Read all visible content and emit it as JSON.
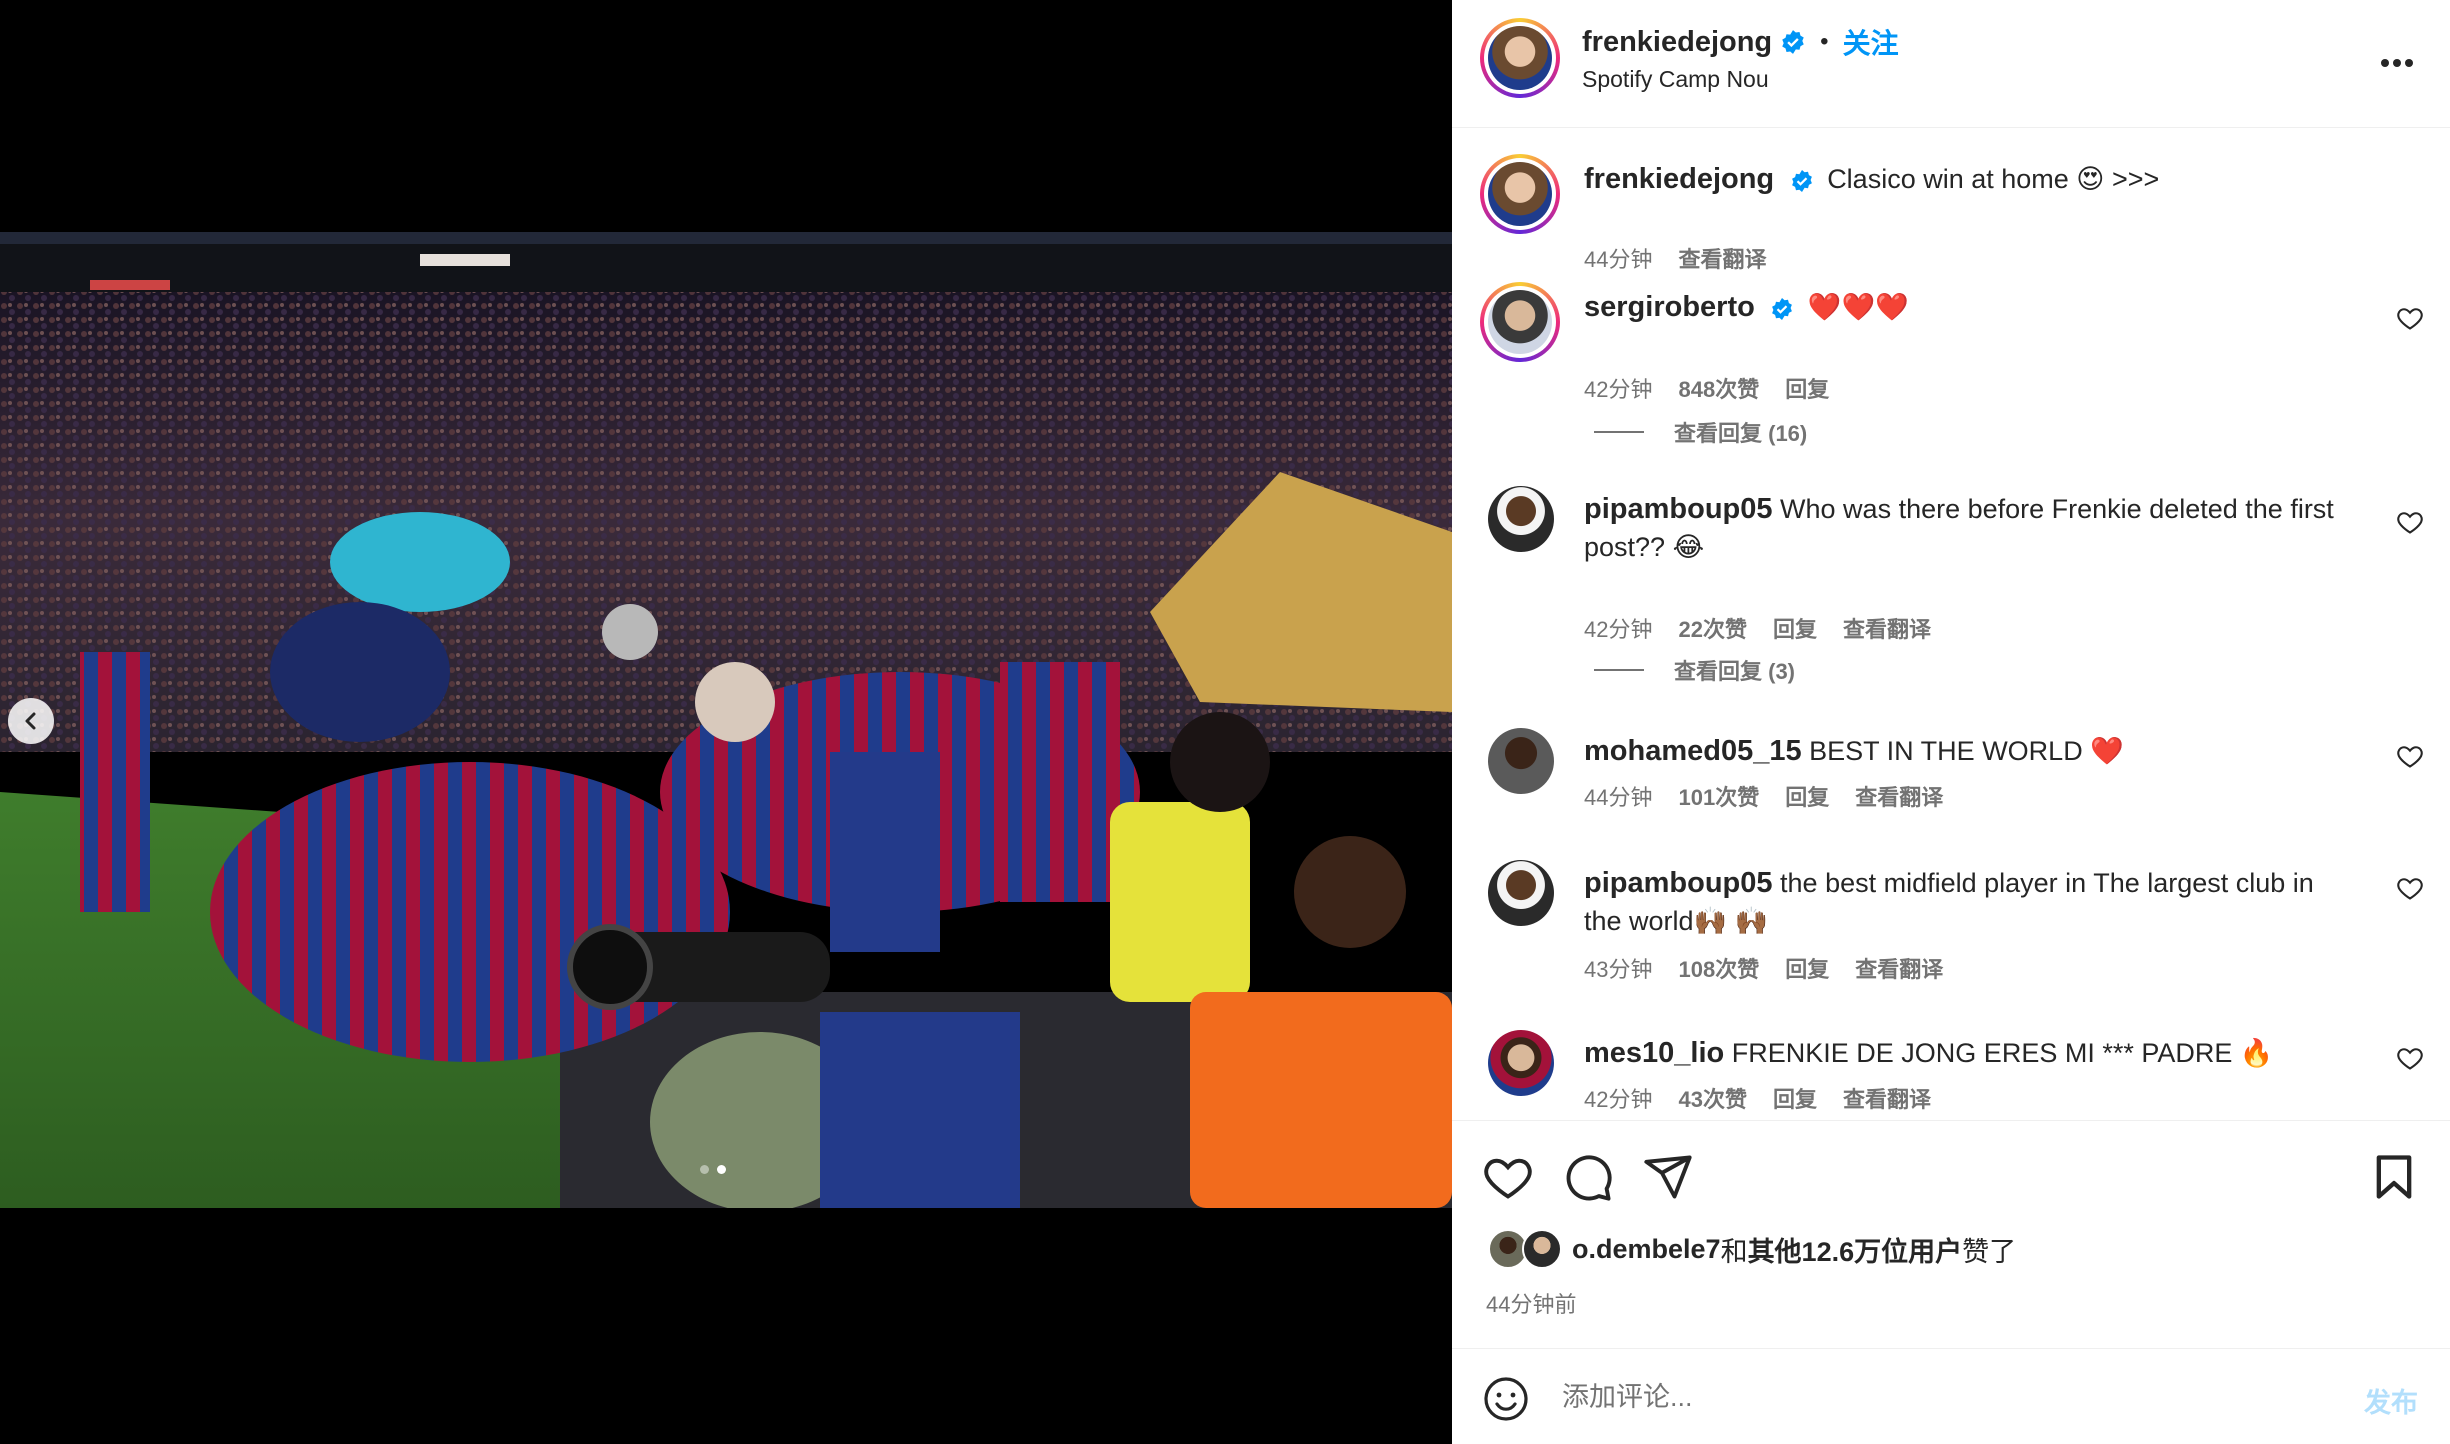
{
  "post": {
    "author": "frenkiedejong",
    "follow_label": "关注",
    "separator": "•",
    "location": "Spotify Camp Nou",
    "more_label": "···"
  },
  "comments": [
    {
      "user": "frenkiedejong",
      "text": "Clasico win at home 😍 >>>",
      "time": "44分钟",
      "likes": "",
      "reply": "",
      "translate": "查看翻译",
      "caption": true
    },
    {
      "user": "sergiroberto",
      "text": "❤️❤️❤️",
      "time": "42分钟",
      "likes": "848次赞",
      "reply": "回复",
      "translate": "",
      "view_replies": "查看回复 (16)"
    },
    {
      "user": "pipamboup05",
      "text": "Who was there before Frenkie deleted the first",
      "text2": "post?? 😂",
      "time": "42分钟",
      "likes": "22次赞",
      "reply": "回复",
      "translate": "查看翻译",
      "view_replies": "查看回复 (3)"
    },
    {
      "user": "mohamed05_15",
      "text": "BEST IN THE WORLD ❤️",
      "time": "44分钟",
      "likes": "101次赞",
      "reply": "回复",
      "translate": "查看翻译"
    },
    {
      "user": "pipamboup05",
      "text": "the best midfield player in The largest club in",
      "text2": "the world🙌🏾 🙌🏾",
      "time": "43分钟",
      "likes": "108次赞",
      "reply": "回复",
      "translate": "查看翻译"
    },
    {
      "user": "mes10_lio",
      "text": "FRENKIE DE JONG ERES MI *** PADRE 🔥",
      "time": "42分钟",
      "likes": "43次赞",
      "reply": "回复",
      "translate": "查看翻译"
    }
  ],
  "likes_summary": {
    "user": "o.dembele7",
    "mid": "和",
    "others": "其他12.6万位用户",
    "tail": "赞了"
  },
  "posted_ago": "44分钟前",
  "composer": {
    "placeholder": "添加评论...",
    "post_label": "发布"
  },
  "icons": [
    "verified-badge-icon",
    "more-icon",
    "heart-icon",
    "comment-icon",
    "share-icon",
    "bookmark-icon",
    "emoji-icon",
    "chevron-left-icon"
  ],
  "colors": {
    "accent": "#0095f6",
    "post_disabled": "#b2dffc",
    "meta": "#737373",
    "text": "#262626"
  },
  "carousel": {
    "total": 2,
    "active": 2
  }
}
